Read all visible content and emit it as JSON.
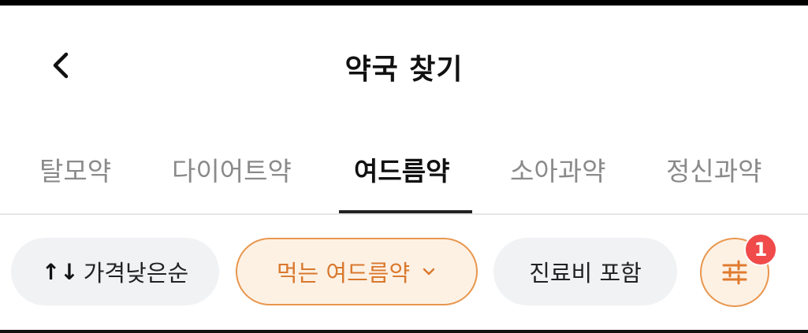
{
  "header": {
    "title": "약국 찾기",
    "back_icon": "chevron-left-icon"
  },
  "tabs": [
    {
      "label": "탈모약",
      "active": false
    },
    {
      "label": "다이어트약",
      "active": false
    },
    {
      "label": "여드름약",
      "active": true
    },
    {
      "label": "소아과약",
      "active": false
    },
    {
      "label": "정신과약",
      "active": false
    }
  ],
  "filters": {
    "sort_icon": "↑↓",
    "sort_label": "가격낮은순",
    "category_label": "먹는 여드름약",
    "category_icon": "chevron-down-icon",
    "fee_label": "진료비 포함",
    "settings_icon": "sliders-icon",
    "settings_badge": "1"
  },
  "colors": {
    "accent": "#e8964d",
    "accent_text": "#d9782d",
    "accent_bg": "#fdf1e4",
    "badge": "#f04a4a",
    "chip_bg": "#f1f2f4"
  }
}
